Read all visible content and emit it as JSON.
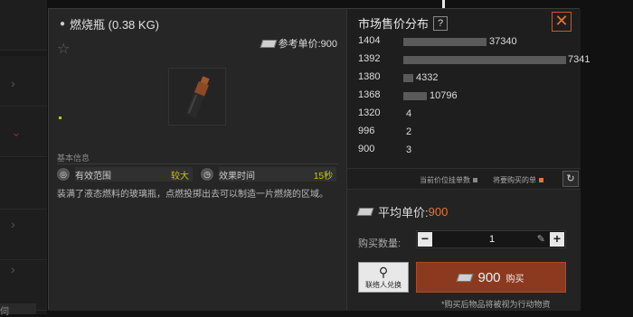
{
  "item": {
    "title": "燃烧瓶 (0.38 KG)",
    "ref_price_label": "参考单价:900",
    "section_label": "基本信息",
    "props": [
      {
        "label": "有效范围",
        "value": "较大"
      },
      {
        "label": "效果时间",
        "value": "15秒"
      }
    ],
    "description": "装满了液态燃料的玻璃瓶，点燃投掷出去可以制造一片燃烧的区域。"
  },
  "market": {
    "title": "市场售价分布",
    "help": "?",
    "close": "✕",
    "legend_listed": "当前价位挂单数",
    "legend_buy": "将要购买的单",
    "accent": "#e8742f"
  },
  "chart_data": {
    "type": "bar",
    "orientation": "horizontal",
    "categories": [
      "1404",
      "1392",
      "1380",
      "1368",
      "1320",
      "996",
      "900"
    ],
    "values": [
      37340,
      73410,
      4332,
      10796,
      4,
      2,
      3
    ],
    "value_labels": [
      "37340",
      "7341",
      "4332",
      "10796",
      "4",
      "2",
      "3"
    ]
  },
  "purchase": {
    "avg_label": "平均单价:",
    "avg_value": "900",
    "qty_label": "购买数量:",
    "qty_value": "1",
    "minus": "−",
    "plus": "+",
    "contact_label": "联络人兑换",
    "buy_price": "900",
    "buy_label": "购买",
    "note": "*购买后物品将被视为行动物资"
  },
  "bg": {
    "corner_text": "伺"
  }
}
